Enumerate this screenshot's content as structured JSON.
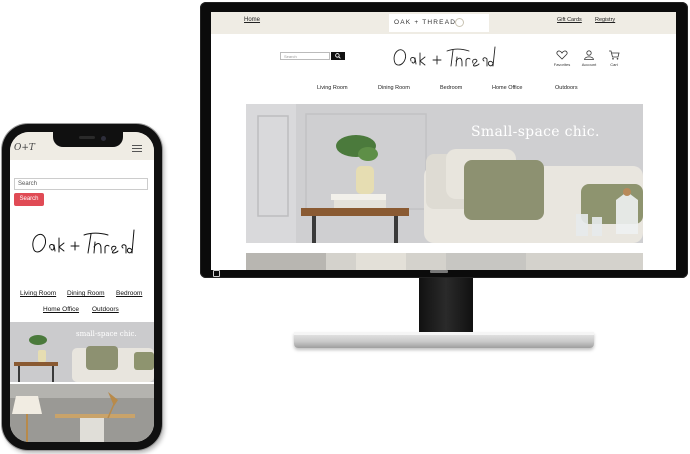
{
  "desktop": {
    "topbar": {
      "home_link": "Home",
      "brand": "OAK + THREAD",
      "gift_cards": "Gift Cards",
      "registry": "Registry"
    },
    "search": {
      "placeholder": "Search"
    },
    "logo": "Oak + Thread",
    "icons": [
      {
        "name": "heart-icon",
        "label": "Favorites"
      },
      {
        "name": "account-icon",
        "label": "Account"
      },
      {
        "name": "cart-icon",
        "label": "Cart"
      }
    ],
    "nav": [
      "Living Room",
      "Dining Room",
      "Bedroom",
      "Home Office",
      "Outdoors"
    ],
    "hero_text": "Small-space chic."
  },
  "mobile": {
    "logo_small": "O+T",
    "search_placeholder": "Search",
    "search_button": "Search",
    "logo": "Oak + Thread",
    "nav": [
      "Living Room",
      "Dining Room",
      "Bedroom",
      "Home Office",
      "Outdoors"
    ],
    "hero_text": "small-space chic."
  },
  "colors": {
    "topbar_bg": "#efece4",
    "search_button": "#e04b55",
    "device_frame": "#101010"
  }
}
